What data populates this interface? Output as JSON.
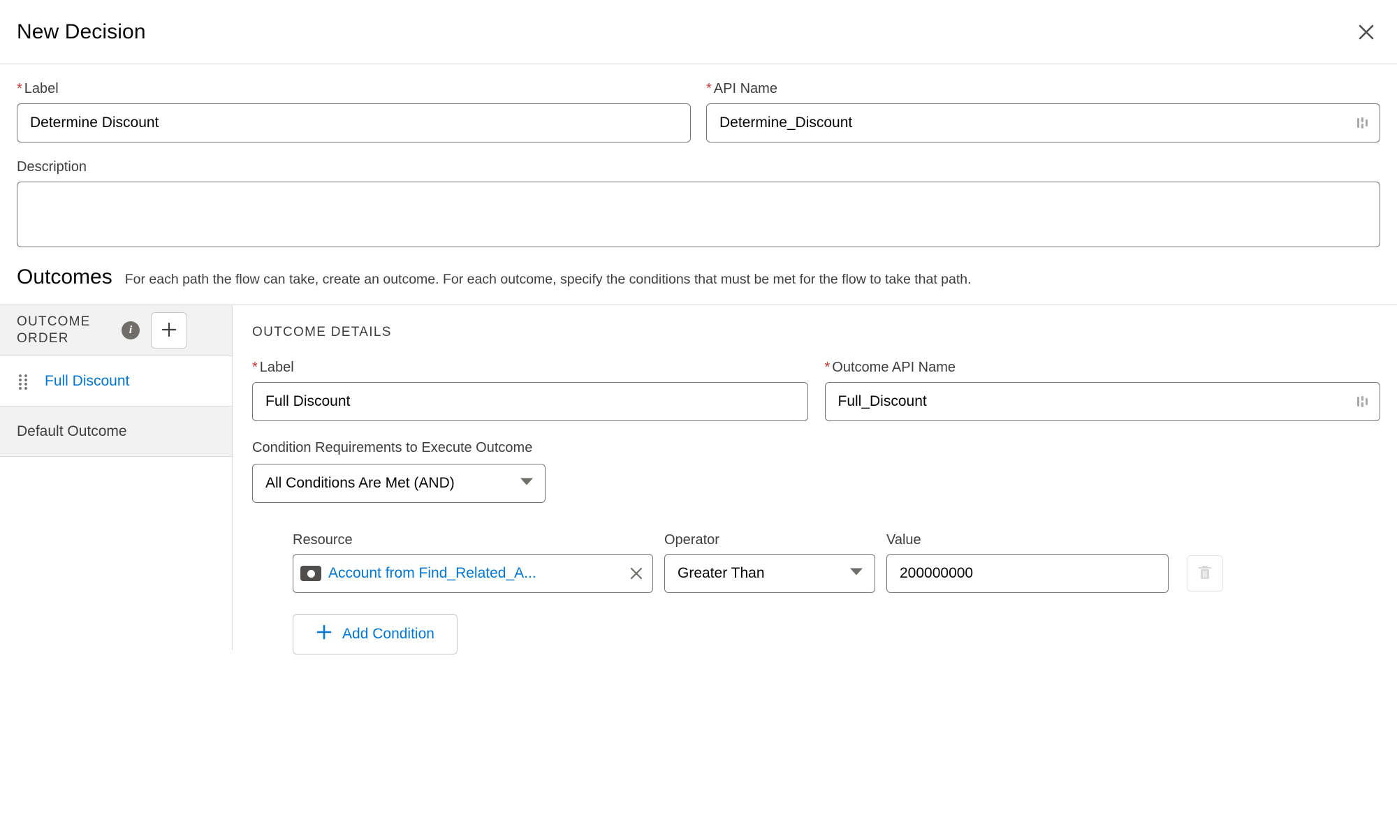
{
  "header": {
    "title": "New Decision",
    "close_icon": "close-icon"
  },
  "form": {
    "label_field": {
      "label": "Label",
      "required_marker": "*",
      "value": "Determine Discount"
    },
    "api_name_field": {
      "label": "API Name",
      "required_marker": "*",
      "value": "Determine_Discount",
      "affix_icon": "resize-grip-icon"
    },
    "description_field": {
      "label": "Description",
      "value": ""
    }
  },
  "outcomes_section": {
    "title": "Outcomes",
    "help_text": "For each path the flow can take, create an outcome. For each outcome, specify the conditions that must be met for the flow to take that path."
  },
  "sidebar": {
    "heading": "OUTCOME ORDER",
    "info_icon": "info-icon",
    "info_glyph": "i",
    "add_button_icon": "plus-icon",
    "items": [
      {
        "label": "Full Discount",
        "selected": true,
        "draggable": true
      },
      {
        "label": "Default Outcome",
        "selected": false,
        "draggable": false
      }
    ]
  },
  "details": {
    "title": "OUTCOME DETAILS",
    "label_field": {
      "label": "Label",
      "required_marker": "*",
      "value": "Full Discount"
    },
    "api_name_field": {
      "label": "Outcome API Name",
      "required_marker": "*",
      "value": "Full_Discount",
      "affix_icon": "resize-grip-icon"
    },
    "condition_requirements": {
      "label": "Condition Requirements to Execute Outcome",
      "selected": "All Conditions Are Met (AND)",
      "caret_icon": "chevron-down-icon"
    },
    "condition_headers": {
      "resource": "Resource",
      "operator": "Operator",
      "value": "Value"
    },
    "condition": {
      "resource_pill": {
        "text": "Account from Find_Related_A...",
        "icon": "record-icon",
        "remove_icon": "close-icon"
      },
      "operator": "Greater Than",
      "operator_caret_icon": "chevron-down-icon",
      "value": "200000000",
      "delete_icon": "trash-icon"
    },
    "add_condition": {
      "label": "Add Condition",
      "icon": "plus-icon"
    }
  },
  "colors": {
    "link_blue": "#0176d3",
    "required_red": "#c23934",
    "border_gray": "#dddbda",
    "input_border": "#747474",
    "header_bg": "#f3f2f2",
    "text_dark": "#080707",
    "text_muted": "#3e3e3c"
  }
}
